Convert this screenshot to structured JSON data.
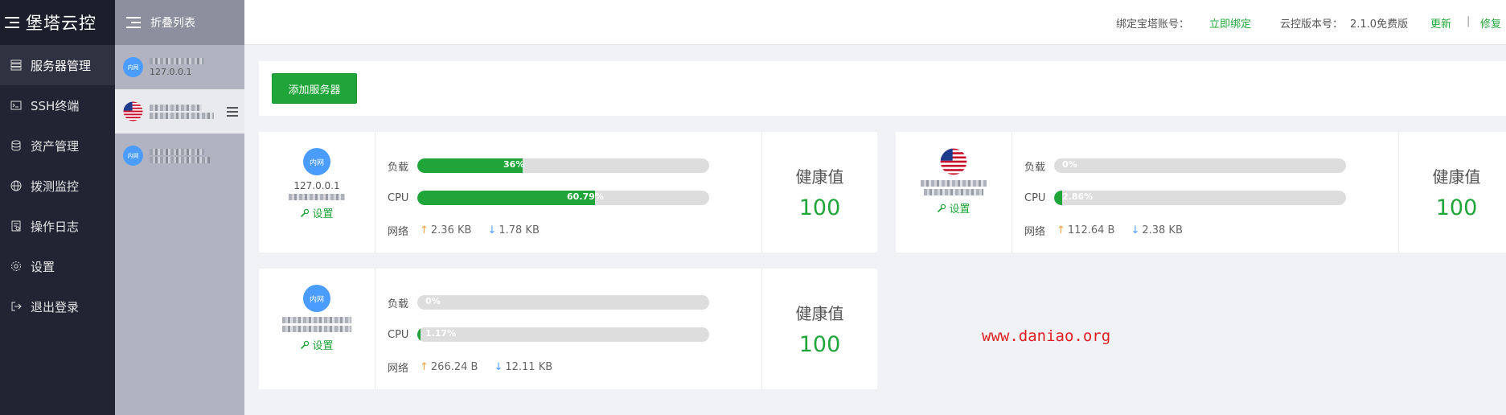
{
  "app": {
    "title": "堡塔云控"
  },
  "nav": {
    "items": [
      {
        "label": "服务器管理",
        "icon": "server-list-icon",
        "active": true
      },
      {
        "label": "SSH终端",
        "icon": "terminal-icon"
      },
      {
        "label": "资产管理",
        "icon": "database-icon"
      },
      {
        "label": "拨测监控",
        "icon": "globe-icon"
      },
      {
        "label": "操作日志",
        "icon": "log-icon"
      },
      {
        "label": "设置",
        "icon": "gear-icon"
      },
      {
        "label": "退出登录",
        "icon": "logout-icon"
      }
    ]
  },
  "list": {
    "title": "折叠列表",
    "servers": [
      {
        "badge": "内网",
        "ip": "127.0.0.1"
      },
      {
        "flag": "us-flag-icon",
        "ip": ""
      },
      {
        "badge": "内网",
        "ip": ""
      }
    ]
  },
  "header": {
    "bind_label": "绑定宝塔账号：",
    "bind_link": "立即绑定",
    "version_label": "云控版本号：",
    "version_value": "2.1.0免费版",
    "update": "更新",
    "divider": "|",
    "repair": "修复"
  },
  "toolbar": {
    "add_server": "添加服务器"
  },
  "cards": [
    {
      "badge": "内网",
      "ip": "127.0.0.1",
      "setting": "设置",
      "load_label": "负载",
      "load": "36%",
      "cpu_label": "CPU",
      "cpu": "60.79%",
      "net_label": "网络",
      "up": "2.36 KB",
      "down": "1.78 KB",
      "health_label": "健康值",
      "health": "100"
    },
    {
      "flag": "us-flag-icon",
      "ip": "",
      "setting": "设置",
      "load_label": "负载",
      "load": "0%",
      "cpu_label": "CPU",
      "cpu": "2.86%",
      "net_label": "网络",
      "up": "112.64 B",
      "down": "2.38 KB",
      "health_label": "健康值",
      "health": "100"
    },
    {
      "badge": "内网",
      "ip": "",
      "setting": "设置",
      "load_label": "负载",
      "load": "0%",
      "cpu_label": "CPU",
      "cpu": "1.17%",
      "net_label": "网络",
      "up": "266.24 B",
      "down": "12.11 KB",
      "health_label": "健康值",
      "health": "100"
    }
  ],
  "watermark": "www.daniao.org",
  "colors": {
    "accent": "#20a53a",
    "badge": "#4a9cff",
    "sidebar": "#222433",
    "watermark": "#e02020"
  }
}
